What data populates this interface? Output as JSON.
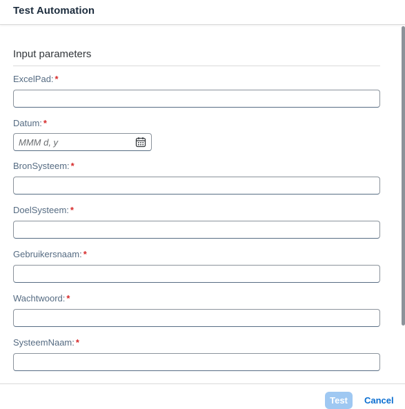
{
  "dialog": {
    "title": "Test Automation"
  },
  "section": {
    "title": "Input parameters"
  },
  "required_marker": "*",
  "fields": {
    "excelpad": {
      "label": "ExcelPad:",
      "value": ""
    },
    "datum": {
      "label": "Datum:",
      "placeholder": "MMM d, y",
      "icon": "calendar-icon"
    },
    "bronsysteem": {
      "label": "BronSysteem:",
      "value": ""
    },
    "doelsysteem": {
      "label": "DoelSysteem:",
      "value": ""
    },
    "gebruikersnaam": {
      "label": "Gebruikersnaam:",
      "value": ""
    },
    "wachtwoord": {
      "label": "Wachtwoord:",
      "value": ""
    },
    "systeemnaam": {
      "label": "SysteemNaam:",
      "value": ""
    }
  },
  "footer": {
    "test_label": "Test",
    "cancel_label": "Cancel"
  },
  "colors": {
    "required": "#d62a2a",
    "link": "#0a6ed1",
    "disabled_button": "#9fc8f2",
    "label": "#556b82"
  }
}
